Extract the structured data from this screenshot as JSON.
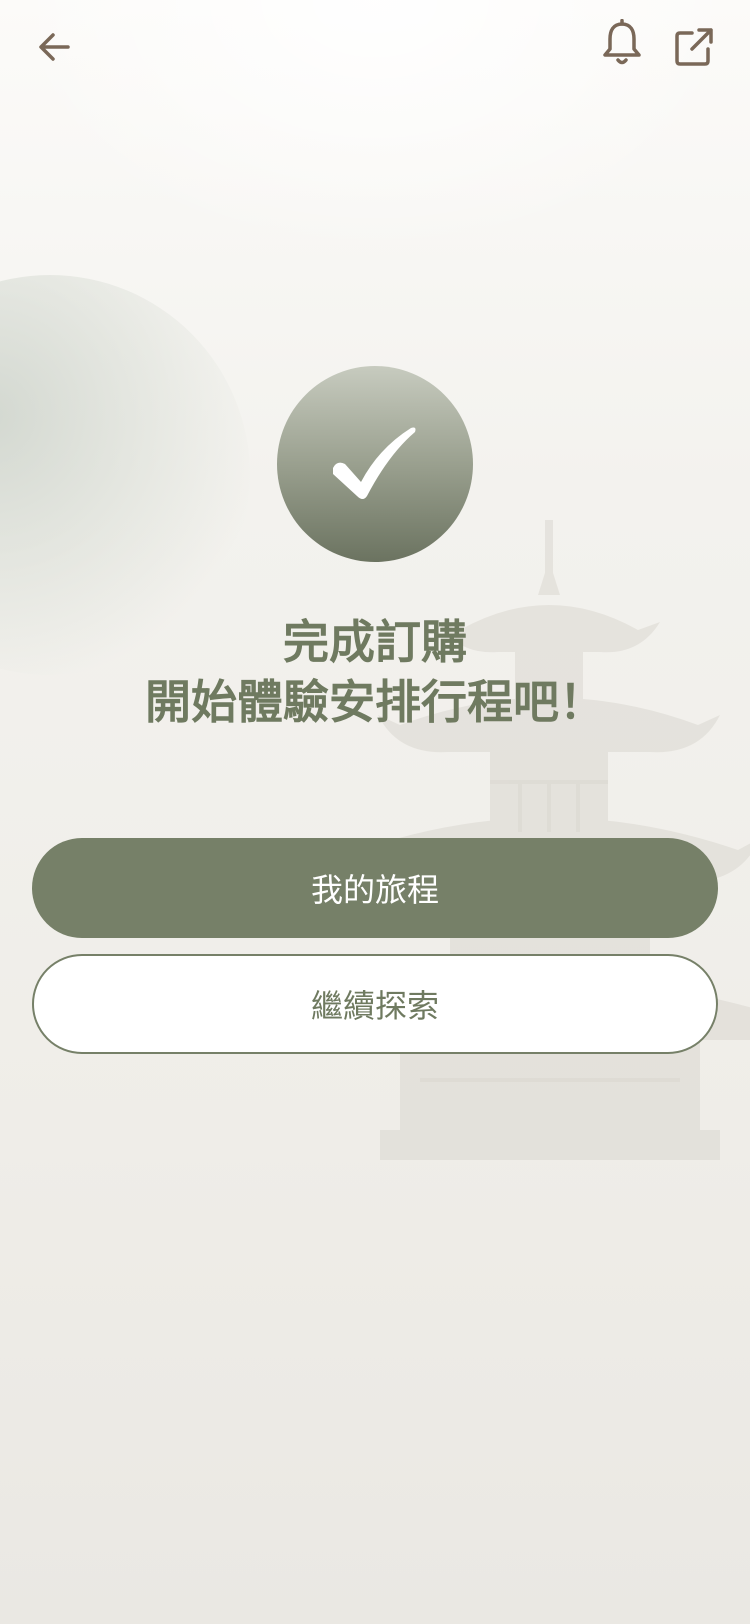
{
  "header": {
    "back_icon": "arrow-left-icon",
    "notification_icon": "bell-icon",
    "share_icon": "external-link-icon"
  },
  "status": {
    "icon": "checkmark-icon",
    "title_line1": "完成訂購",
    "title_line2": "開始體驗安排行程吧！"
  },
  "actions": {
    "primary_label": "我的旅程",
    "secondary_label": "繼續探索"
  },
  "colors": {
    "accent": "#768068",
    "title_text": "#6f7a60",
    "icon": "#7a6858",
    "background": "#f1f0ec"
  }
}
